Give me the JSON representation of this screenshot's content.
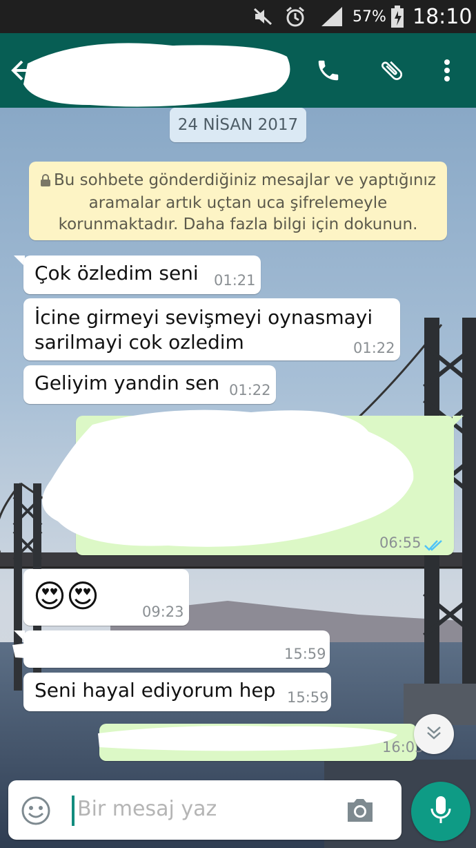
{
  "status_bar": {
    "battery_percent": "57%",
    "time": "18:10",
    "icons": [
      "mute-icon",
      "alarm-icon",
      "signal-icon",
      "battery-icon"
    ]
  },
  "toolbar": {
    "contact_name": "",
    "icons": [
      "back-arrow-icon",
      "phone-icon",
      "attach-icon",
      "more-vert-icon"
    ]
  },
  "chat": {
    "date_chip": "24 NİSAN 2017",
    "encryption_notice": {
      "line1": "Bu sohbete gönderdiğiniz mesajlar ve yaptığınız",
      "line2": "aramalar artık uçtan uca şifrelemeyle",
      "line3": "korunmaktadır. Daha fazla bilgi için dokunun."
    },
    "messages": [
      {
        "direction": "in",
        "lines": [
          "Çok özledim seni"
        ],
        "time": "01:21"
      },
      {
        "direction": "in",
        "lines": [
          "İcine girmeyi sevişmeyi oynasmayi",
          "sarilmayi cok ozledim"
        ],
        "time": "01:22"
      },
      {
        "direction": "in",
        "lines": [
          "Geliyim yandin sen"
        ],
        "time": "01:22"
      },
      {
        "direction": "out",
        "lines": [
          ""
        ],
        "time": "06:55",
        "status": "read"
      },
      {
        "direction": "in",
        "lines": [
          "😍😍"
        ],
        "time": "09:23"
      },
      {
        "direction": "in",
        "lines": [
          ""
        ],
        "time": "15:59"
      },
      {
        "direction": "in",
        "lines": [
          "Seni hayal ediyorum hep"
        ],
        "time": "15:59"
      },
      {
        "direction": "out",
        "lines": [
          ""
        ],
        "time": "16:05",
        "status": "read"
      }
    ]
  },
  "composer": {
    "placeholder": "Bir mesaj yaz",
    "icons": [
      "emoji-icon",
      "camera-icon",
      "mic-icon",
      "scroll-down-icon"
    ]
  },
  "colors": {
    "header": "#075e54",
    "outgoing_bubble": "#dcf8c6",
    "incoming_bubble": "#ffffff",
    "read_ticks": "#4fc3f7",
    "mic_button": "#0e9b85"
  }
}
